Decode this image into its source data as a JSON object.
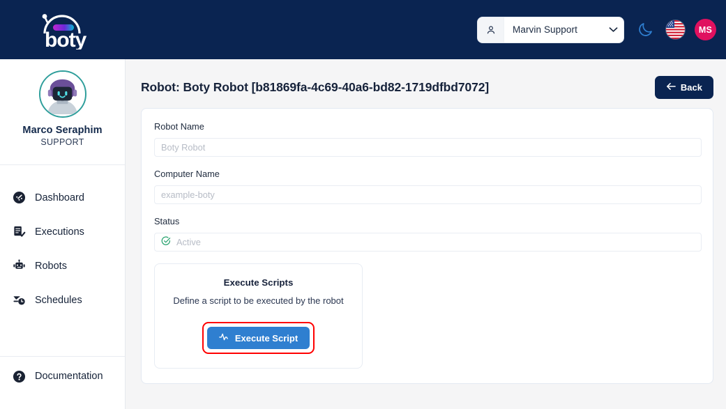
{
  "brand": {
    "name": "boty"
  },
  "topbar": {
    "user_select": {
      "icon": "person-icon",
      "value": "Marvin Support",
      "chevron": "chevron-down-icon"
    },
    "theme_toggle": {
      "icon": "moon-icon",
      "label": "Dark mode"
    },
    "language": {
      "icon": "us-flag-icon",
      "label": "English (US)"
    },
    "avatar": {
      "initials": "MS",
      "color": "#e0115f"
    }
  },
  "sidebar": {
    "profile": {
      "name": "Marco Seraphim",
      "role": "SUPPORT",
      "avatar": "robot-avatar"
    },
    "items": [
      {
        "label": "Dashboard",
        "icon": "dashboard-icon"
      },
      {
        "label": "Executions",
        "icon": "executions-icon"
      },
      {
        "label": "Robots",
        "icon": "robot-icon"
      },
      {
        "label": "Schedules",
        "icon": "schedules-icon"
      }
    ],
    "footer": {
      "label": "Documentation",
      "icon": "help-circle-icon"
    }
  },
  "page": {
    "title": "Robot: Boty Robot [b81869fa-4c69-40a6-bd82-1719dfbd7072]",
    "back_label": "Back",
    "back_icon": "arrow-left-icon"
  },
  "form": {
    "robot_name": {
      "label": "Robot Name",
      "value": "",
      "placeholder": "Boty Robot"
    },
    "computer_name": {
      "label": "Computer Name",
      "value": "",
      "placeholder": "example-boty"
    },
    "status": {
      "label": "Status",
      "value": "Active",
      "icon": "check-circle-icon",
      "icon_color": "#22a06b"
    }
  },
  "execute_scripts": {
    "title": "Execute Scripts",
    "subtitle": "Define a script to be executed by the robot",
    "button_label": "Execute Script",
    "button_icon": "pulse-icon",
    "button_color": "#2f7fd0",
    "highlight_color": "#ff0000"
  },
  "colors": {
    "header_bg": "#0a2451",
    "page_bg": "#f5f5f6",
    "sidebar_bg": "#ffffff",
    "accent": "#2f7fd0"
  }
}
